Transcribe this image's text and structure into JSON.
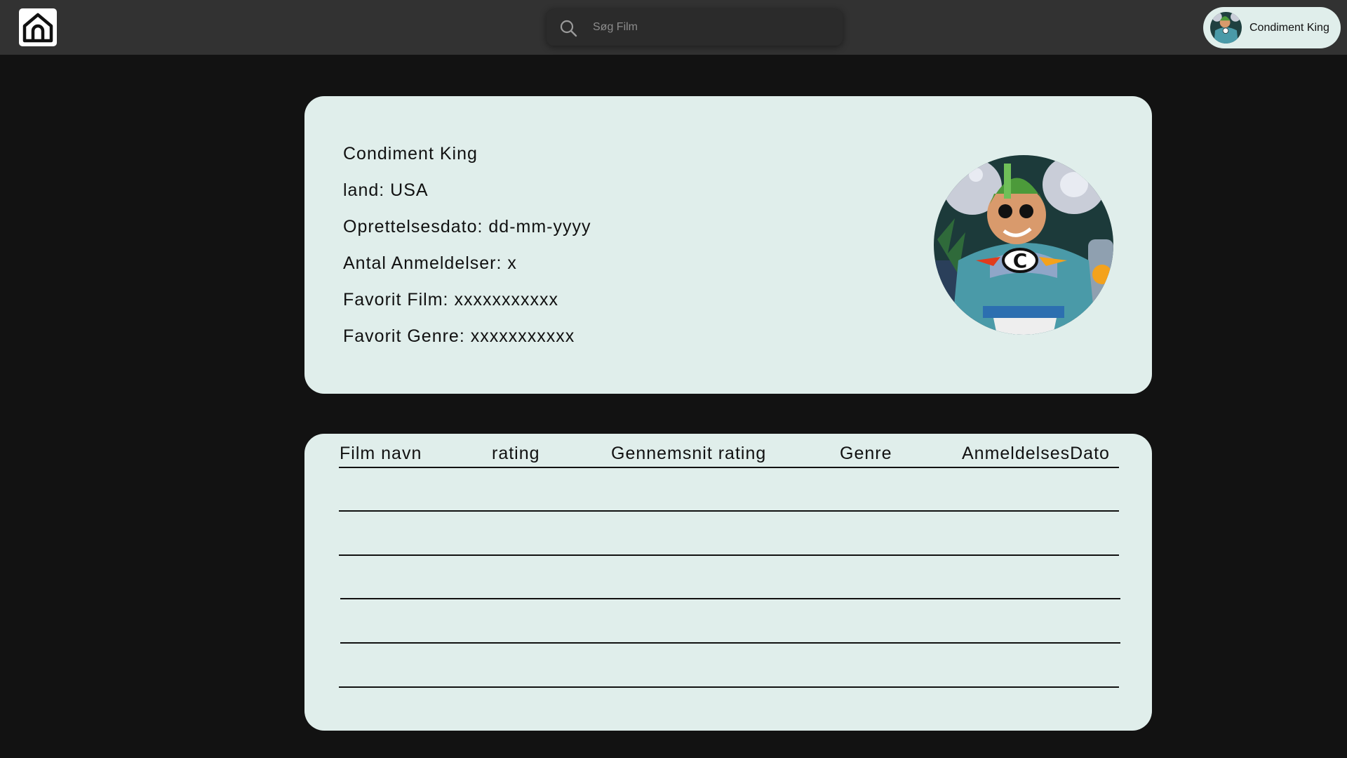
{
  "header": {
    "home_icon": "home-icon",
    "search": {
      "icon": "search-icon",
      "placeholder": "Søg Film",
      "value": ""
    },
    "user": {
      "name": "Condiment King",
      "avatar": "avatar-image"
    }
  },
  "profile": {
    "name": "Condiment King",
    "country": "land: USA",
    "created": "Oprettelsesdato: dd-mm-yyyy",
    "review_count": "Antal Anmeldelser: x",
    "favorite_film": "Favorit Film: xxxxxxxxxxx",
    "favorite_genre": "Favorit Genre: xxxxxxxxxxx",
    "avatar": "avatar-image"
  },
  "reviews": {
    "columns": [
      "Film navn",
      "rating",
      "Gennemsnit rating",
      "Genre",
      "AnmeldelsesDato"
    ],
    "rows": [
      [],
      [],
      [],
      [],
      []
    ]
  },
  "colors": {
    "page_background": "#121212",
    "topbar": "#323232",
    "card": "#e0eeeb",
    "text": "#111111"
  }
}
